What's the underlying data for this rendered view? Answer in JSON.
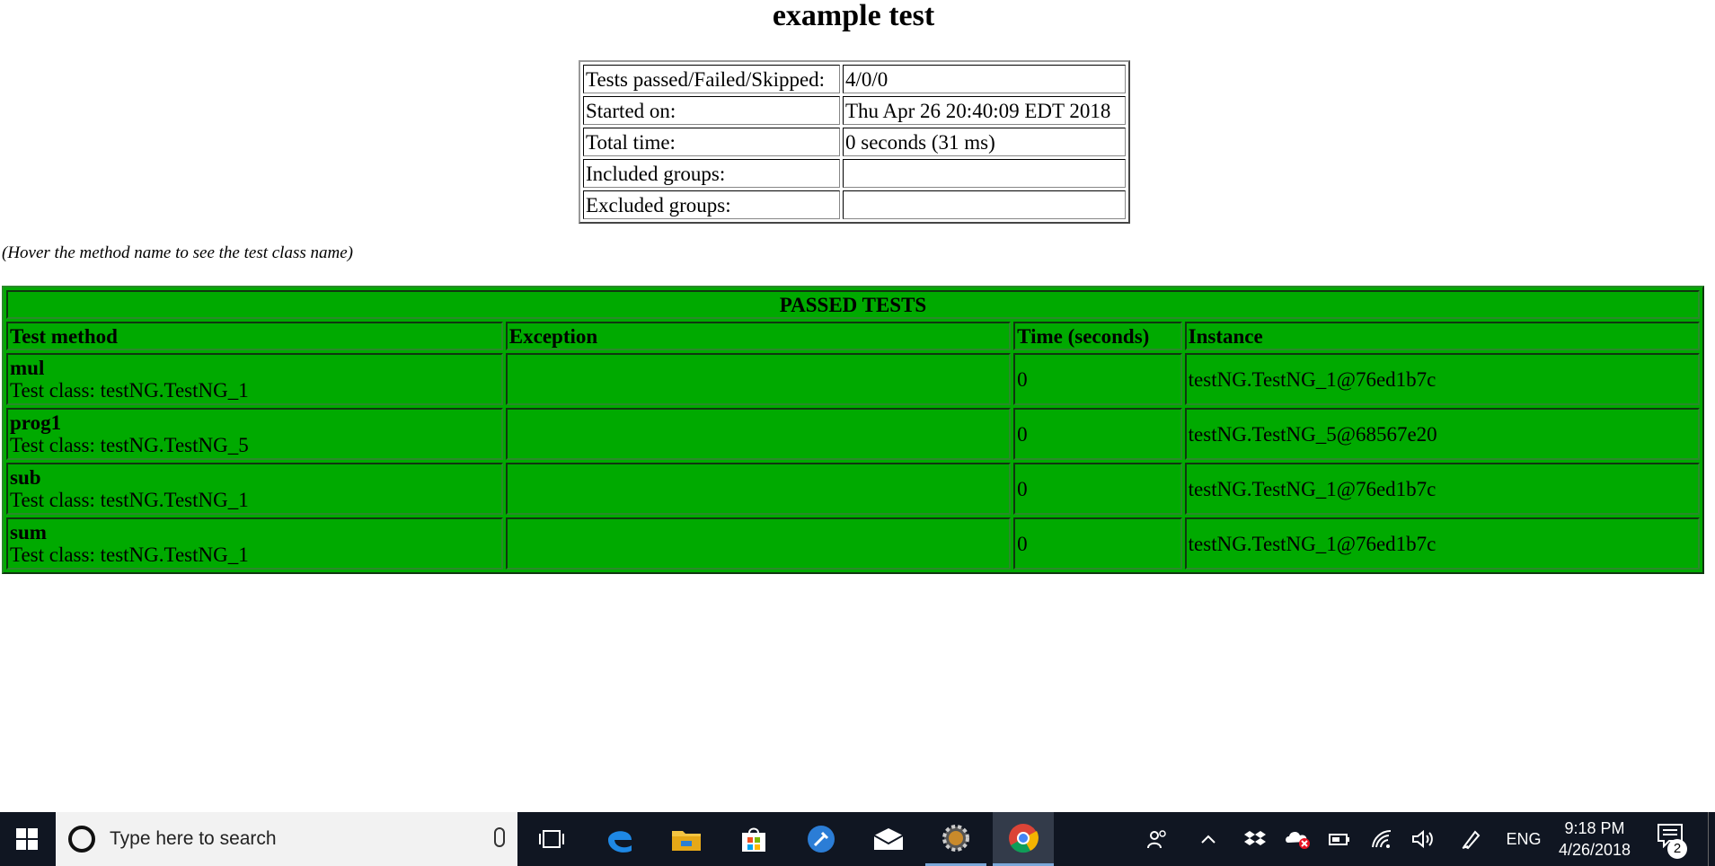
{
  "report": {
    "title": "example test",
    "summary": [
      {
        "label": "Tests passed/Failed/Skipped:",
        "value": "4/0/0"
      },
      {
        "label": "Started on:",
        "value": "Thu Apr 26 20:40:09 EDT 2018"
      },
      {
        "label": "Total time:",
        "value": "0 seconds (31 ms)"
      },
      {
        "label": "Included groups:",
        "value": ""
      },
      {
        "label": "Excluded groups:",
        "value": ""
      }
    ],
    "hint": "(Hover the method name to see the test class name)",
    "passed_header": "PASSED TESTS",
    "columns": [
      "Test method",
      "Exception",
      "Time (seconds)",
      "Instance"
    ],
    "rows": [
      {
        "method": "mul",
        "test_class": "Test class: testNG.TestNG_1",
        "exception": "",
        "time": "0",
        "instance": "testNG.TestNG_1@76ed1b7c"
      },
      {
        "method": "prog1",
        "test_class": "Test class: testNG.TestNG_5",
        "exception": "",
        "time": "0",
        "instance": "testNG.TestNG_5@68567e20"
      },
      {
        "method": "sub",
        "test_class": "Test class: testNG.TestNG_1",
        "exception": "",
        "time": "0",
        "instance": "testNG.TestNG_1@76ed1b7c"
      },
      {
        "method": "sum",
        "test_class": "Test class: testNG.TestNG_1",
        "exception": "",
        "time": "0",
        "instance": "testNG.TestNG_1@76ed1b7c"
      }
    ],
    "colors": {
      "passed_bg": "#00aa00",
      "border": "#2a8a2a"
    }
  },
  "taskbar": {
    "search_placeholder": "Type here to search",
    "apps": [
      "task-view-icon",
      "edge-icon",
      "file-explorer-icon",
      "store-icon",
      "app-settings-icon",
      "mail-icon",
      "gear-app-icon",
      "chrome-icon"
    ],
    "tray": {
      "language": "ENG",
      "time": "9:18 PM",
      "date": "4/26/2018",
      "notification_count": "2"
    },
    "colors": {
      "bar_bg": "#101622",
      "search_bg": "#f2f2f2"
    }
  }
}
